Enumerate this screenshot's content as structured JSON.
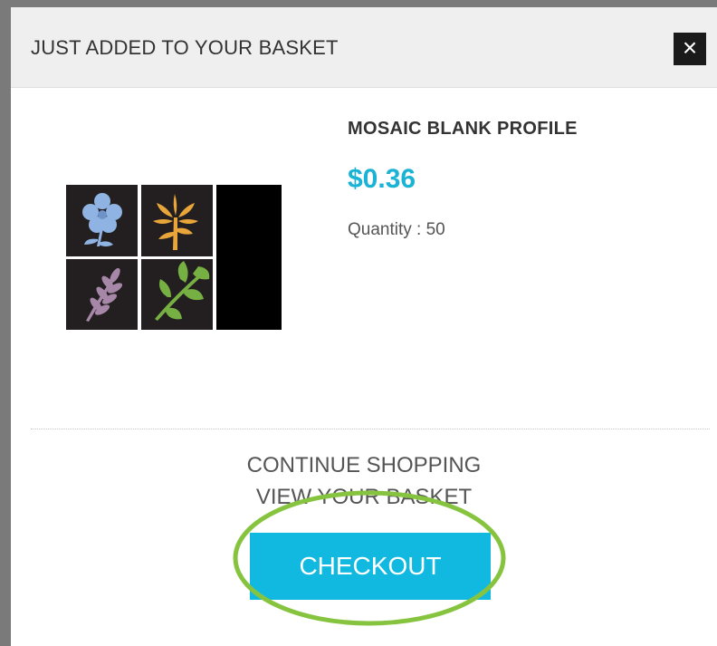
{
  "modal": {
    "title": "JUST ADDED TO YOUR BASKET",
    "close_label": "×"
  },
  "product": {
    "name": "MOSAIC BLANK PROFILE",
    "price": "$0.36",
    "quantity_text": "Quantity : 50",
    "image_tiles": [
      {
        "icon": "blue-flower-icon",
        "color": "#8fb4e3"
      },
      {
        "icon": "orange-lily-icon",
        "color": "#e8a53a"
      },
      {
        "icon": "purple-wheat-icon",
        "color": "#a687a8"
      },
      {
        "icon": "green-leaves-icon",
        "color": "#76b043"
      }
    ]
  },
  "actions": {
    "continue_shopping": "CONTINUE SHOPPING",
    "view_basket": "VIEW YOUR BASKET",
    "checkout": "CHECKOUT"
  },
  "colors": {
    "accent": "#11b9e0",
    "price": "#1ab3d6",
    "highlight_ring": "#86c440"
  }
}
